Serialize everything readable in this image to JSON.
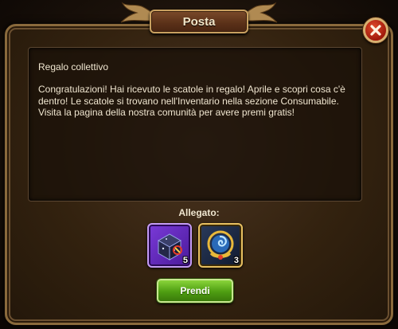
{
  "dialog": {
    "title": "Posta",
    "close_icon": "close-icon"
  },
  "message": {
    "subject": "Regalo collettivo",
    "body": "Congratulazioni! Hai ricevuto le scatole in regalo! Aprile e scopri cosa c'è dentro! Le scatole si trovano nell'Inventario nella sezione Consumabile. Visita la pagina della nostra comunità per avere premi gratis!"
  },
  "attachments": {
    "label": "Allegato:",
    "items": [
      {
        "icon": "mystery-chest-icon",
        "quantity": "5",
        "frame_color": "#c49cf4"
      },
      {
        "icon": "artifact-amulet-icon",
        "quantity": "3",
        "frame_color": "#e8c060"
      }
    ]
  },
  "actions": {
    "take_label": "Prendi",
    "take_color": "#5eb01a"
  }
}
